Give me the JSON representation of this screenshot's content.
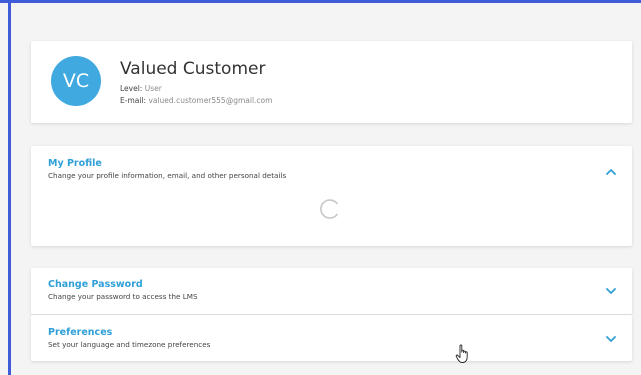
{
  "profile": {
    "initials": "VC",
    "name": "Valued Customer",
    "level_label": "Level:",
    "level_value": "User",
    "email_label": "E-mail:",
    "email_value": "valued.customer555@gmail.com"
  },
  "sections": {
    "my_profile": {
      "title": "My Profile",
      "description": "Change your profile information, email, and other personal details",
      "expanded": true,
      "icon": "chevron-up-icon"
    },
    "change_password": {
      "title": "Change Password",
      "description": "Change your password to access the LMS",
      "expanded": false,
      "icon": "chevron-down-icon"
    },
    "preferences": {
      "title": "Preferences",
      "description": "Set your language and timezone preferences",
      "expanded": false,
      "icon": "chevron-down-icon"
    }
  },
  "colors": {
    "accent": "#2f9fd7",
    "avatar_bg": "#3fa9e0",
    "frame": "#3f5bd8"
  }
}
